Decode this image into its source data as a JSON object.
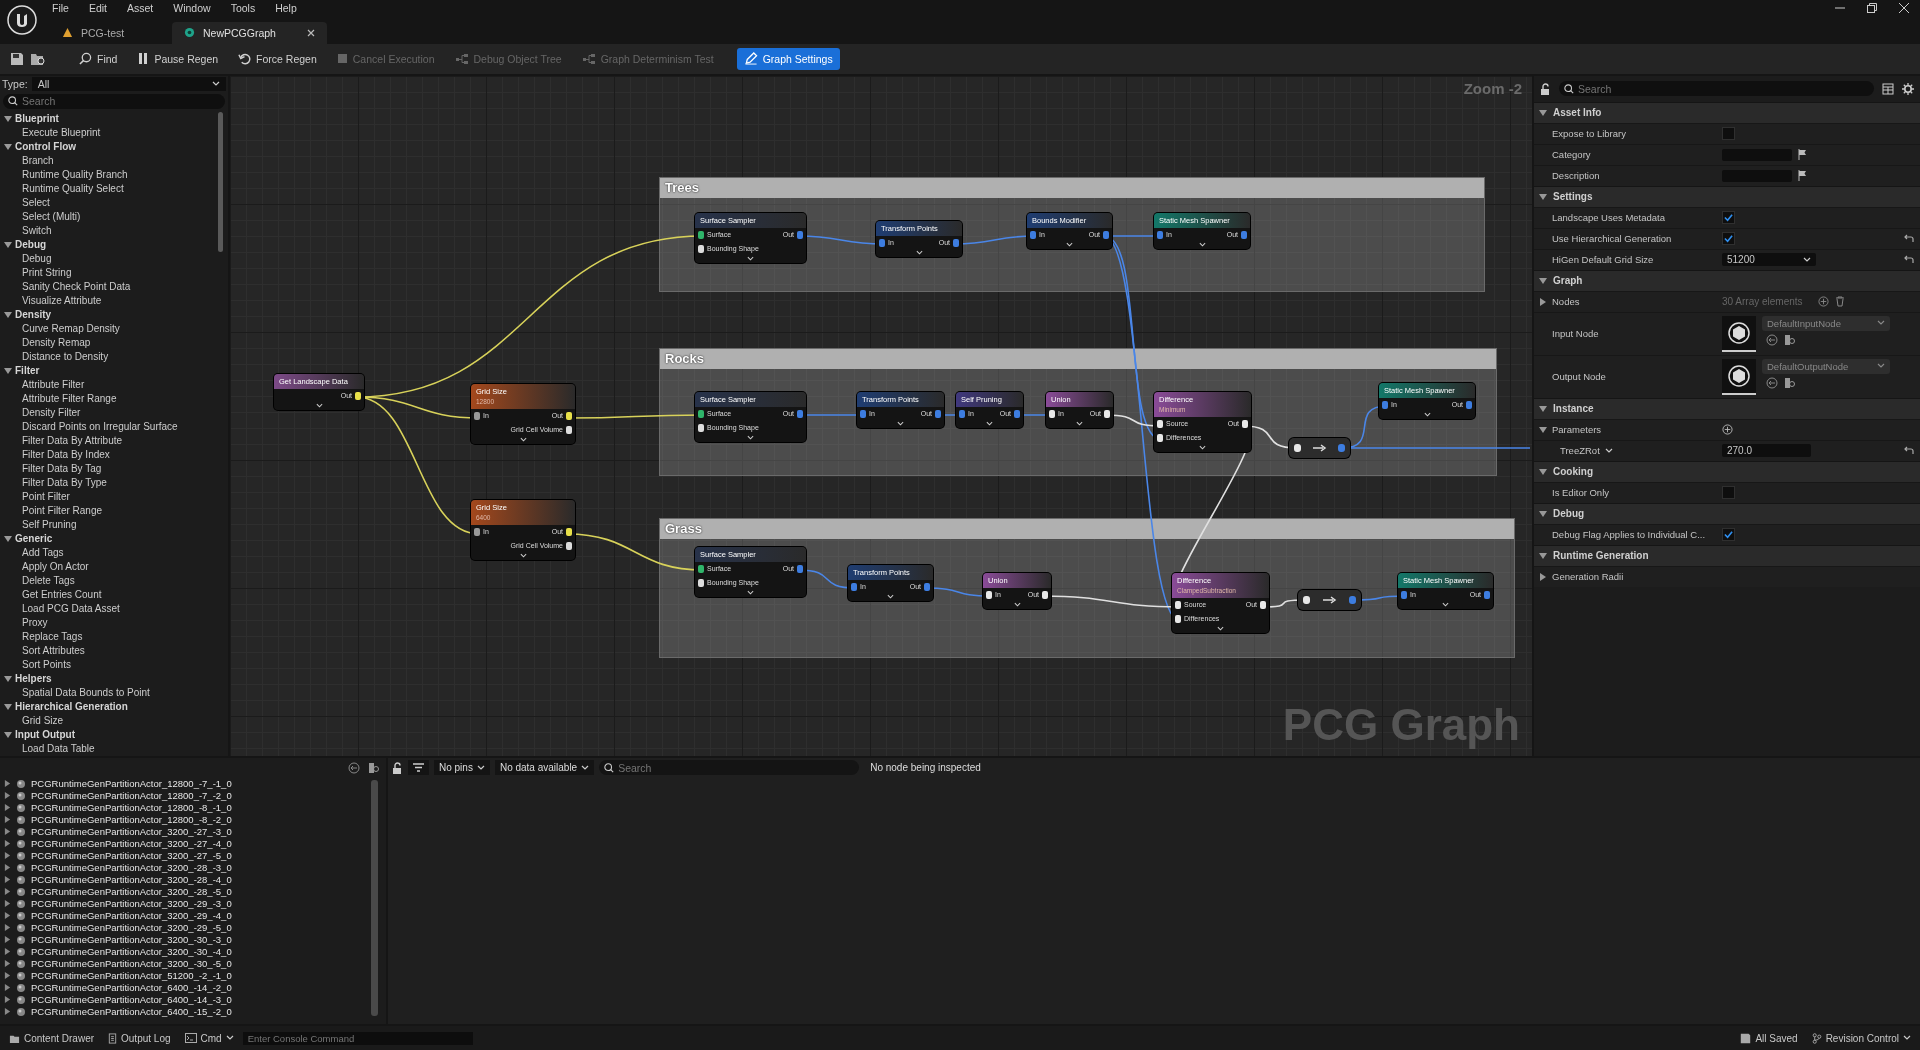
{
  "menu": [
    "File",
    "Edit",
    "Asset",
    "Window",
    "Tools",
    "Help"
  ],
  "tabs": [
    {
      "label": "PCG-test",
      "selected": false
    },
    {
      "label": "NewPCGGraph",
      "selected": true
    }
  ],
  "toolbar": [
    {
      "label": "Find",
      "disabled": false,
      "active": false
    },
    {
      "label": "Pause Regen",
      "disabled": false,
      "active": false
    },
    {
      "label": "Force Regen",
      "disabled": false,
      "active": false
    },
    {
      "label": "Cancel Execution",
      "disabled": true,
      "active": false
    },
    {
      "label": "Debug Object Tree",
      "disabled": true,
      "active": false
    },
    {
      "label": "Graph Determinism Test",
      "disabled": true,
      "active": false
    },
    {
      "label": "Graph Settings",
      "disabled": false,
      "active": true
    }
  ],
  "palette": {
    "type_label": "Type:",
    "type_value": "All",
    "search_placeholder": "Search",
    "categories": [
      {
        "label": "Blueprint",
        "expanded": true,
        "children": [
          {
            "label": "Execute Blueprint"
          }
        ]
      },
      {
        "label": "Control Flow",
        "expanded": true,
        "children": [
          {
            "label": "Branch"
          },
          {
            "label": "Runtime Quality Branch"
          },
          {
            "label": "Runtime Quality Select"
          },
          {
            "label": "Select"
          },
          {
            "label": "Select (Multi)"
          },
          {
            "label": "Switch"
          }
        ]
      },
      {
        "label": "Debug",
        "expanded": true,
        "children": [
          {
            "label": "Debug"
          },
          {
            "label": "Print String"
          },
          {
            "label": "Sanity Check Point Data"
          },
          {
            "label": "Visualize Attribute"
          }
        ]
      },
      {
        "label": "Density",
        "expanded": true,
        "children": [
          {
            "label": "Curve Remap Density"
          },
          {
            "label": "Density Remap"
          },
          {
            "label": "Distance to Density"
          }
        ]
      },
      {
        "label": "Filter",
        "expanded": true,
        "children": [
          {
            "label": "Attribute Filter"
          },
          {
            "label": "Attribute Filter Range"
          },
          {
            "label": "Density Filter"
          },
          {
            "label": "Discard Points on Irregular Surface"
          },
          {
            "label": "Filter Data By Attribute"
          },
          {
            "label": "Filter Data By Index"
          },
          {
            "label": "Filter Data By Tag"
          },
          {
            "label": "Filter Data By Type"
          },
          {
            "label": "Point Filter"
          },
          {
            "label": "Point Filter Range"
          },
          {
            "label": "Self Pruning"
          }
        ]
      },
      {
        "label": "Generic",
        "expanded": true,
        "children": [
          {
            "label": "Add Tags"
          },
          {
            "label": "Apply On Actor"
          },
          {
            "label": "Delete Tags"
          },
          {
            "label": "Get Entries Count"
          },
          {
            "label": "Load PCG Data Asset"
          },
          {
            "label": "Proxy"
          },
          {
            "label": "Replace Tags"
          },
          {
            "label": "Sort Attributes"
          },
          {
            "label": "Sort Points"
          }
        ]
      },
      {
        "label": "Helpers",
        "expanded": true,
        "children": [
          {
            "label": "Spatial Data Bounds to Point"
          }
        ]
      },
      {
        "label": "Hierarchical Generation",
        "expanded": true,
        "children": [
          {
            "label": "Grid Size"
          }
        ]
      },
      {
        "label": "Input Output",
        "expanded": true,
        "children": [
          {
            "label": "Load Data Table"
          }
        ]
      }
    ]
  },
  "graph": {
    "zoom_label": "Zoom -2",
    "graph_label": "PCG Graph",
    "comments": [
      {
        "title": "Trees"
      },
      {
        "title": "Rocks"
      },
      {
        "title": "Grass"
      }
    ],
    "nodes": [
      {
        "kind": "data",
        "title": "Get Landscape Data",
        "rows": [
          {
            "out": "Out"
          }
        ]
      },
      {
        "kind": "hierarchy",
        "title": "Grid Size",
        "subtitle": "12800",
        "rows": [
          {
            "in": "In",
            "out": "Out"
          },
          {
            "out": "Grid Cell Volume"
          }
        ]
      },
      {
        "kind": "hierarchy",
        "title": "Grid Size",
        "subtitle": "6400",
        "rows": [
          {
            "in": "In",
            "out": "Out"
          },
          {
            "out": "Grid Cell Volume"
          }
        ]
      },
      {
        "kind": "sampler",
        "title": "Surface Sampler",
        "rows": [
          {
            "in": "Surface",
            "out": "Out"
          },
          {
            "in": "Bounding Shape"
          }
        ]
      },
      {
        "kind": "points",
        "title": "Transform Points",
        "rows": [
          {
            "in": "In",
            "out": "Out"
          }
        ]
      },
      {
        "kind": "points",
        "title": "Bounds Modifier",
        "rows": [
          {
            "in": "In",
            "out": "Out"
          }
        ]
      },
      {
        "kind": "spawner",
        "title": "Static Mesh Spawner",
        "rows": [
          {
            "in": "In",
            "out": "Out"
          }
        ]
      },
      {
        "kind": "sampler",
        "title": "Surface Sampler",
        "rows": [
          {
            "in": "Surface",
            "out": "Out"
          },
          {
            "in": "Bounding Shape"
          }
        ]
      },
      {
        "kind": "points",
        "title": "Transform Points",
        "rows": [
          {
            "in": "In",
            "out": "Out"
          }
        ]
      },
      {
        "kind": "filter",
        "title": "Self Pruning",
        "rows": [
          {
            "in": "In",
            "out": "Out"
          }
        ]
      },
      {
        "kind": "spatial",
        "title": "Union",
        "rows": [
          {
            "in": "In",
            "out": "Out"
          }
        ]
      },
      {
        "kind": "spatial",
        "title": "Difference",
        "subtitle": "Minimum",
        "rows": [
          {
            "in": "Source",
            "out": "Out"
          },
          {
            "in": "Differences"
          }
        ]
      },
      {
        "kind": "reroute"
      },
      {
        "kind": "spawner",
        "title": "Static Mesh Spawner",
        "rows": [
          {
            "in": "In",
            "out": "Out"
          }
        ]
      },
      {
        "kind": "sampler",
        "title": "Surface Sampler",
        "rows": [
          {
            "in": "Surface",
            "out": "Out"
          },
          {
            "in": "Bounding Shape"
          }
        ]
      },
      {
        "kind": "points",
        "title": "Transform Points",
        "rows": [
          {
            "in": "In",
            "out": "Out"
          }
        ]
      },
      {
        "kind": "spatial",
        "title": "Union",
        "rows": [
          {
            "in": "In",
            "out": "Out"
          }
        ]
      },
      {
        "kind": "spatial",
        "title": "Difference",
        "subtitle": "ClampedSubtraction",
        "rows": [
          {
            "in": "Source",
            "out": "Out"
          },
          {
            "in": "Differences"
          }
        ]
      },
      {
        "kind": "reroute"
      },
      {
        "kind": "spawner",
        "title": "Static Mesh Spawner",
        "rows": [
          {
            "in": "In",
            "out": "Out"
          }
        ]
      }
    ]
  },
  "details": {
    "search_placeholder": "Search",
    "sections": [
      {
        "title": "Asset Info",
        "expanded": true,
        "rows": [
          {
            "kind": "checkbox",
            "label": "Expose to Library",
            "checked": false,
            "reset": false
          },
          {
            "kind": "text",
            "label": "Category",
            "reset": false
          },
          {
            "kind": "text",
            "label": "Description",
            "reset": false
          }
        ]
      },
      {
        "title": "Settings",
        "expanded": true,
        "rows": [
          {
            "kind": "checkbox",
            "label": "Landscape Uses Metadata",
            "checked": true,
            "reset": false
          },
          {
            "kind": "checkbox",
            "label": "Use Hierarchical Generation",
            "checked": true,
            "reset": true
          },
          {
            "kind": "combo",
            "label": "HiGen Default Grid Size",
            "value": "51200",
            "reset": true
          }
        ]
      },
      {
        "title": "Graph",
        "expanded": true,
        "rows": [
          {
            "kind": "array",
            "label": "Nodes",
            "value": "30 Array elements",
            "expanded": false,
            "reset": false
          },
          {
            "kind": "asset",
            "label": "Input Node",
            "value": "DefaultInputNode",
            "reset": false
          },
          {
            "kind": "asset",
            "label": "Output Node",
            "value": "DefaultOutputNode",
            "reset": false
          }
        ]
      },
      {
        "title": "Instance",
        "expanded": true,
        "rows": [
          {
            "kind": "group",
            "label": "Parameters",
            "expanded": true,
            "reset": false,
            "children": [
              {
                "kind": "param",
                "label": "TreeZRot",
                "value": "270.0",
                "reset": true
              }
            ]
          }
        ]
      },
      {
        "title": "Cooking",
        "expanded": true,
        "rows": [
          {
            "kind": "checkbox",
            "label": "Is Editor Only",
            "checked": false,
            "reset": false
          }
        ]
      },
      {
        "title": "Debug",
        "expanded": true,
        "rows": [
          {
            "kind": "checkbox",
            "label": "Debug Flag Applies to Individual C...",
            "checked": true,
            "reset": false
          }
        ]
      },
      {
        "title": "Runtime Generation",
        "expanded": true,
        "rows": [
          {
            "kind": "group",
            "label": "Generation Radii",
            "expanded": false,
            "reset": false,
            "children": []
          }
        ]
      }
    ]
  },
  "actors": [
    {
      "label": "PCGRuntimeGenPartitionActor_12800_-7_-1_0",
      "expanded": false
    },
    {
      "label": "PCGRuntimeGenPartitionActor_12800_-7_-2_0",
      "expanded": false
    },
    {
      "label": "PCGRuntimeGenPartitionActor_12800_-8_-1_0",
      "expanded": false
    },
    {
      "label": "PCGRuntimeGenPartitionActor_12800_-8_-2_0",
      "expanded": false
    },
    {
      "label": "PCGRuntimeGenPartitionActor_3200_-27_-3_0",
      "expanded": false
    },
    {
      "label": "PCGRuntimeGenPartitionActor_3200_-27_-4_0",
      "expanded": false
    },
    {
      "label": "PCGRuntimeGenPartitionActor_3200_-27_-5_0",
      "expanded": false
    },
    {
      "label": "PCGRuntimeGenPartitionActor_3200_-28_-3_0",
      "expanded": false
    },
    {
      "label": "PCGRuntimeGenPartitionActor_3200_-28_-4_0",
      "expanded": false
    },
    {
      "label": "PCGRuntimeGenPartitionActor_3200_-28_-5_0",
      "expanded": false
    },
    {
      "label": "PCGRuntimeGenPartitionActor_3200_-29_-3_0",
      "expanded": false
    },
    {
      "label": "PCGRuntimeGenPartitionActor_3200_-29_-4_0",
      "expanded": false
    },
    {
      "label": "PCGRuntimeGenPartitionActor_3200_-29_-5_0",
      "expanded": false
    },
    {
      "label": "PCGRuntimeGenPartitionActor_3200_-30_-3_0",
      "expanded": false
    },
    {
      "label": "PCGRuntimeGenPartitionActor_3200_-30_-4_0",
      "expanded": false
    },
    {
      "label": "PCGRuntimeGenPartitionActor_3200_-30_-5_0",
      "expanded": false
    },
    {
      "label": "PCGRuntimeGenPartitionActor_51200_-2_-1_0",
      "expanded": false
    },
    {
      "label": "PCGRuntimeGenPartitionActor_6400_-14_-2_0",
      "expanded": false
    },
    {
      "label": "PCGRuntimeGenPartitionActor_6400_-14_-3_0",
      "expanded": false
    },
    {
      "label": "PCGRuntimeGenPartitionActor_6400_-15_-2_0",
      "expanded": false
    }
  ],
  "inspector": {
    "pins_filter": "No pins",
    "data_filter": "No data available",
    "search_placeholder": "Search",
    "status": "No node being inspected"
  },
  "status_bar": {
    "content_drawer": "Content Drawer",
    "output_log": "Output Log",
    "cmd": "Cmd",
    "console_placeholder": "Enter Console Command",
    "saved": "All Saved",
    "revision": "Revision Control"
  }
}
